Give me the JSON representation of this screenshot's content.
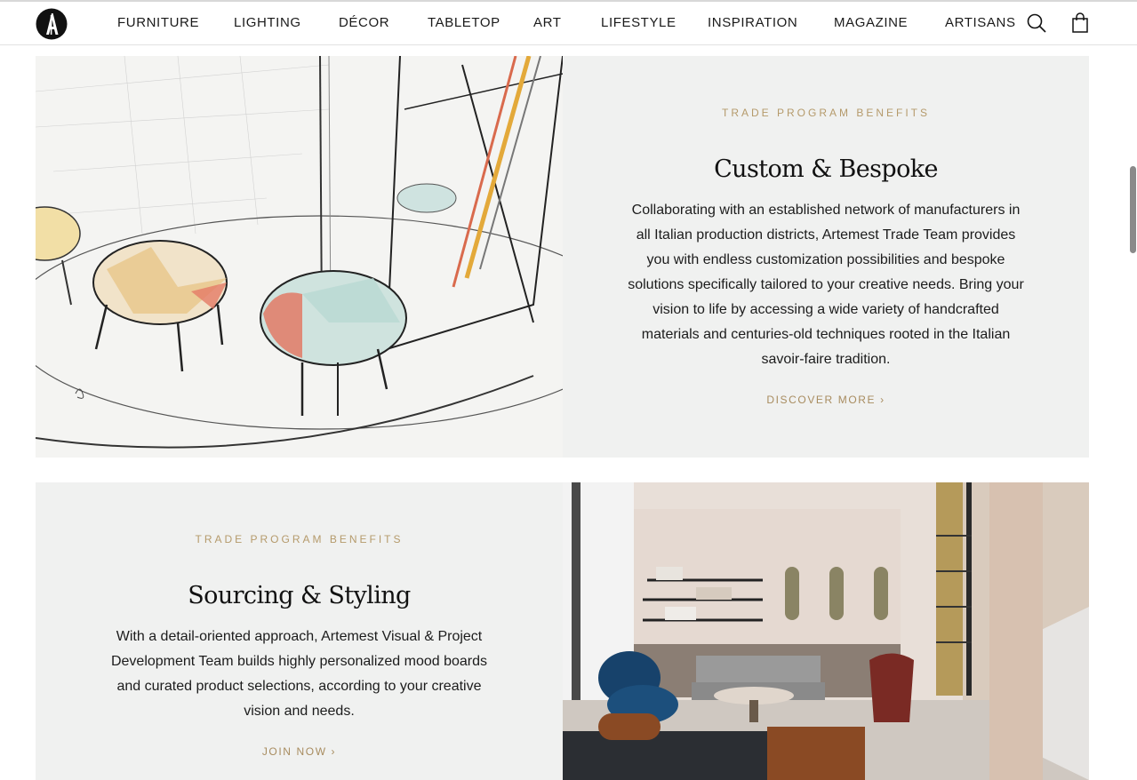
{
  "header": {
    "logo_alt": "Artemest",
    "nav": [
      "FURNITURE",
      "LIGHTING",
      "DÉCOR",
      "TABLETOP",
      "ART",
      "LIFESTYLE",
      "INSPIRATION",
      "MAGAZINE",
      "ARTISANS"
    ],
    "icons": [
      "search-icon",
      "shopping-bag-icon"
    ]
  },
  "sections": [
    {
      "eyebrow": "TRADE PROGRAM BENEFITS",
      "title": "Custom & Bespoke",
      "body": "Collaborating with an established network of manufacturers in all Italian production districts, Artemest Trade Team provides you with endless customization possibilities and bespoke solutions specifically tailored to your creative needs. Bring your vision to life by accessing a wide variety of handcrafted materials and centuries-old techniques rooted in the Italian savoir-faire tradition.",
      "cta": "DISCOVER MORE ›"
    },
    {
      "eyebrow": "TRADE PROGRAM BENEFITS",
      "title": "Sourcing & Styling",
      "body": "With a detail-oriented approach, Artemest Visual & Project Development Team builds highly personalized mood boards and curated product selections, according to your creative vision and needs.",
      "cta": "JOIN NOW ›"
    }
  ],
  "colors": {
    "accent_gold": "#b59a6b",
    "panel_bg": "#f0f1f0"
  }
}
